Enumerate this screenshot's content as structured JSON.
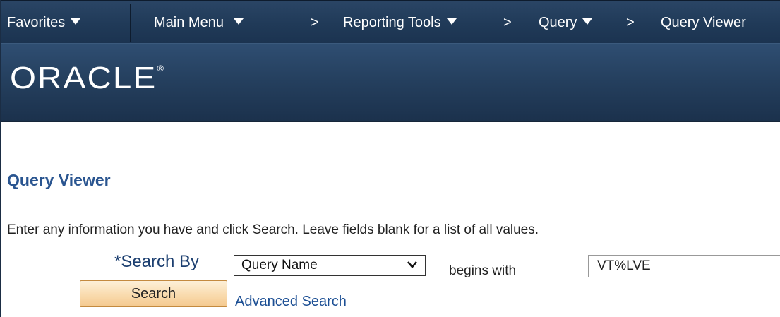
{
  "nav": {
    "favorites": "Favorites",
    "main_menu": "Main Menu",
    "breadcrumb_sep": ">",
    "reporting_tools": "Reporting Tools",
    "query": "Query",
    "query_viewer": "Query Viewer"
  },
  "branding": {
    "logo_text": "ORACLE",
    "logo_mark": "®"
  },
  "page": {
    "title": "Query Viewer",
    "instructions": "Enter any information you have and click Search. Leave fields blank for a list of all values."
  },
  "search": {
    "search_by_label": "*Search By",
    "search_by_value": "Query Name",
    "operator": "begins with",
    "value": "VT%LVE",
    "search_button": "Search",
    "advanced_search": "Advanced Search"
  },
  "colors": {
    "nav_background": "#203a58",
    "title_blue": "#2a5590",
    "button_fill": "#f9dbae",
    "link_blue": "#1c4f94"
  }
}
